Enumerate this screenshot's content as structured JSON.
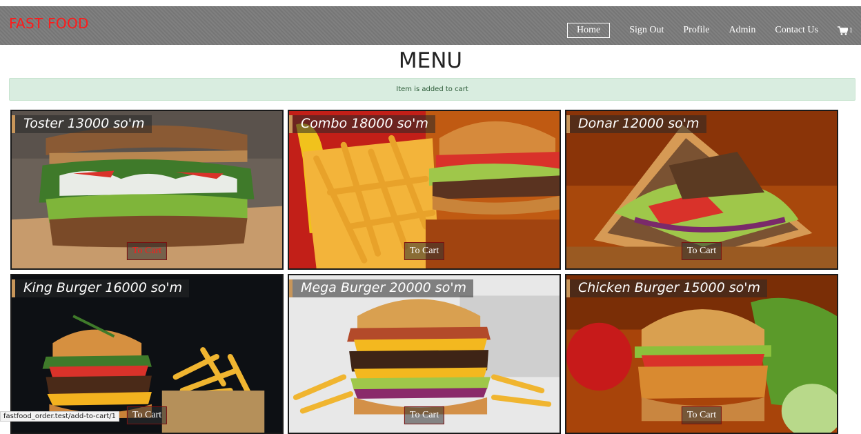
{
  "brand": "FAST FOOD",
  "nav": {
    "items": [
      "Home",
      "Sign Out",
      "Profile",
      "Admin",
      "Contact Us"
    ],
    "cart_count": "1"
  },
  "title": "MENU",
  "alert": "Item is added to cart",
  "cart_label": "To Cart",
  "products": [
    {
      "name": "Toster 13000 so'm"
    },
    {
      "name": "Combo 18000 so'm"
    },
    {
      "name": "Donar 12000 so'm"
    },
    {
      "name": "King Burger 16000 so'm"
    },
    {
      "name": "Mega Burger 20000 so'm"
    },
    {
      "name": "Chicken Burger 15000 so'm"
    }
  ],
  "status_url": "fastfood_order.test/add-to-cart/1",
  "colors": {
    "brand": "#ff1a1a",
    "navbar": "#7b7b7b",
    "alert_bg": "#d9ede0"
  }
}
